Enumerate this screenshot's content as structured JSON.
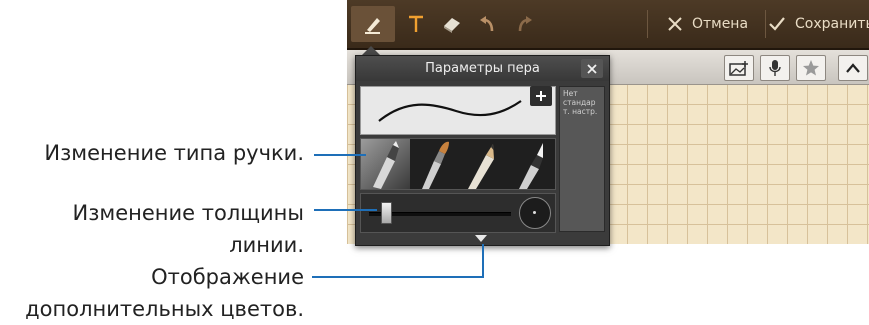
{
  "toolbar": {
    "icons": [
      "pen-icon",
      "text-icon",
      "eraser-icon",
      "undo-icon",
      "redo-icon"
    ],
    "cancel_label": "Отмена",
    "save_label": "Сохранить"
  },
  "subbar": {
    "icons": [
      "insert-image-icon",
      "microphone-icon",
      "star-icon",
      "chevron-up-icon"
    ]
  },
  "pen_settings": {
    "title": "Параметры пера",
    "preset_text": "Нет стандар т. настр.",
    "pen_types": [
      "marker",
      "brush",
      "pencil",
      "pen"
    ],
    "selected_pen_type": "marker",
    "thickness_fraction": 0.12
  },
  "annotations": {
    "pen_type": "Изменение типа ручки.",
    "thickness_line1": "Изменение толщины",
    "thickness_line2": "линии.",
    "colors_line1": "Отображение",
    "colors_line2": "дополнительных цветов."
  },
  "colors": {
    "toolbar": "#3f2e1e",
    "canvas": "#f3e6c8",
    "grid": "#d7c19a",
    "popup": "#3b3b3b",
    "callout_line": "#1e6fb8"
  }
}
